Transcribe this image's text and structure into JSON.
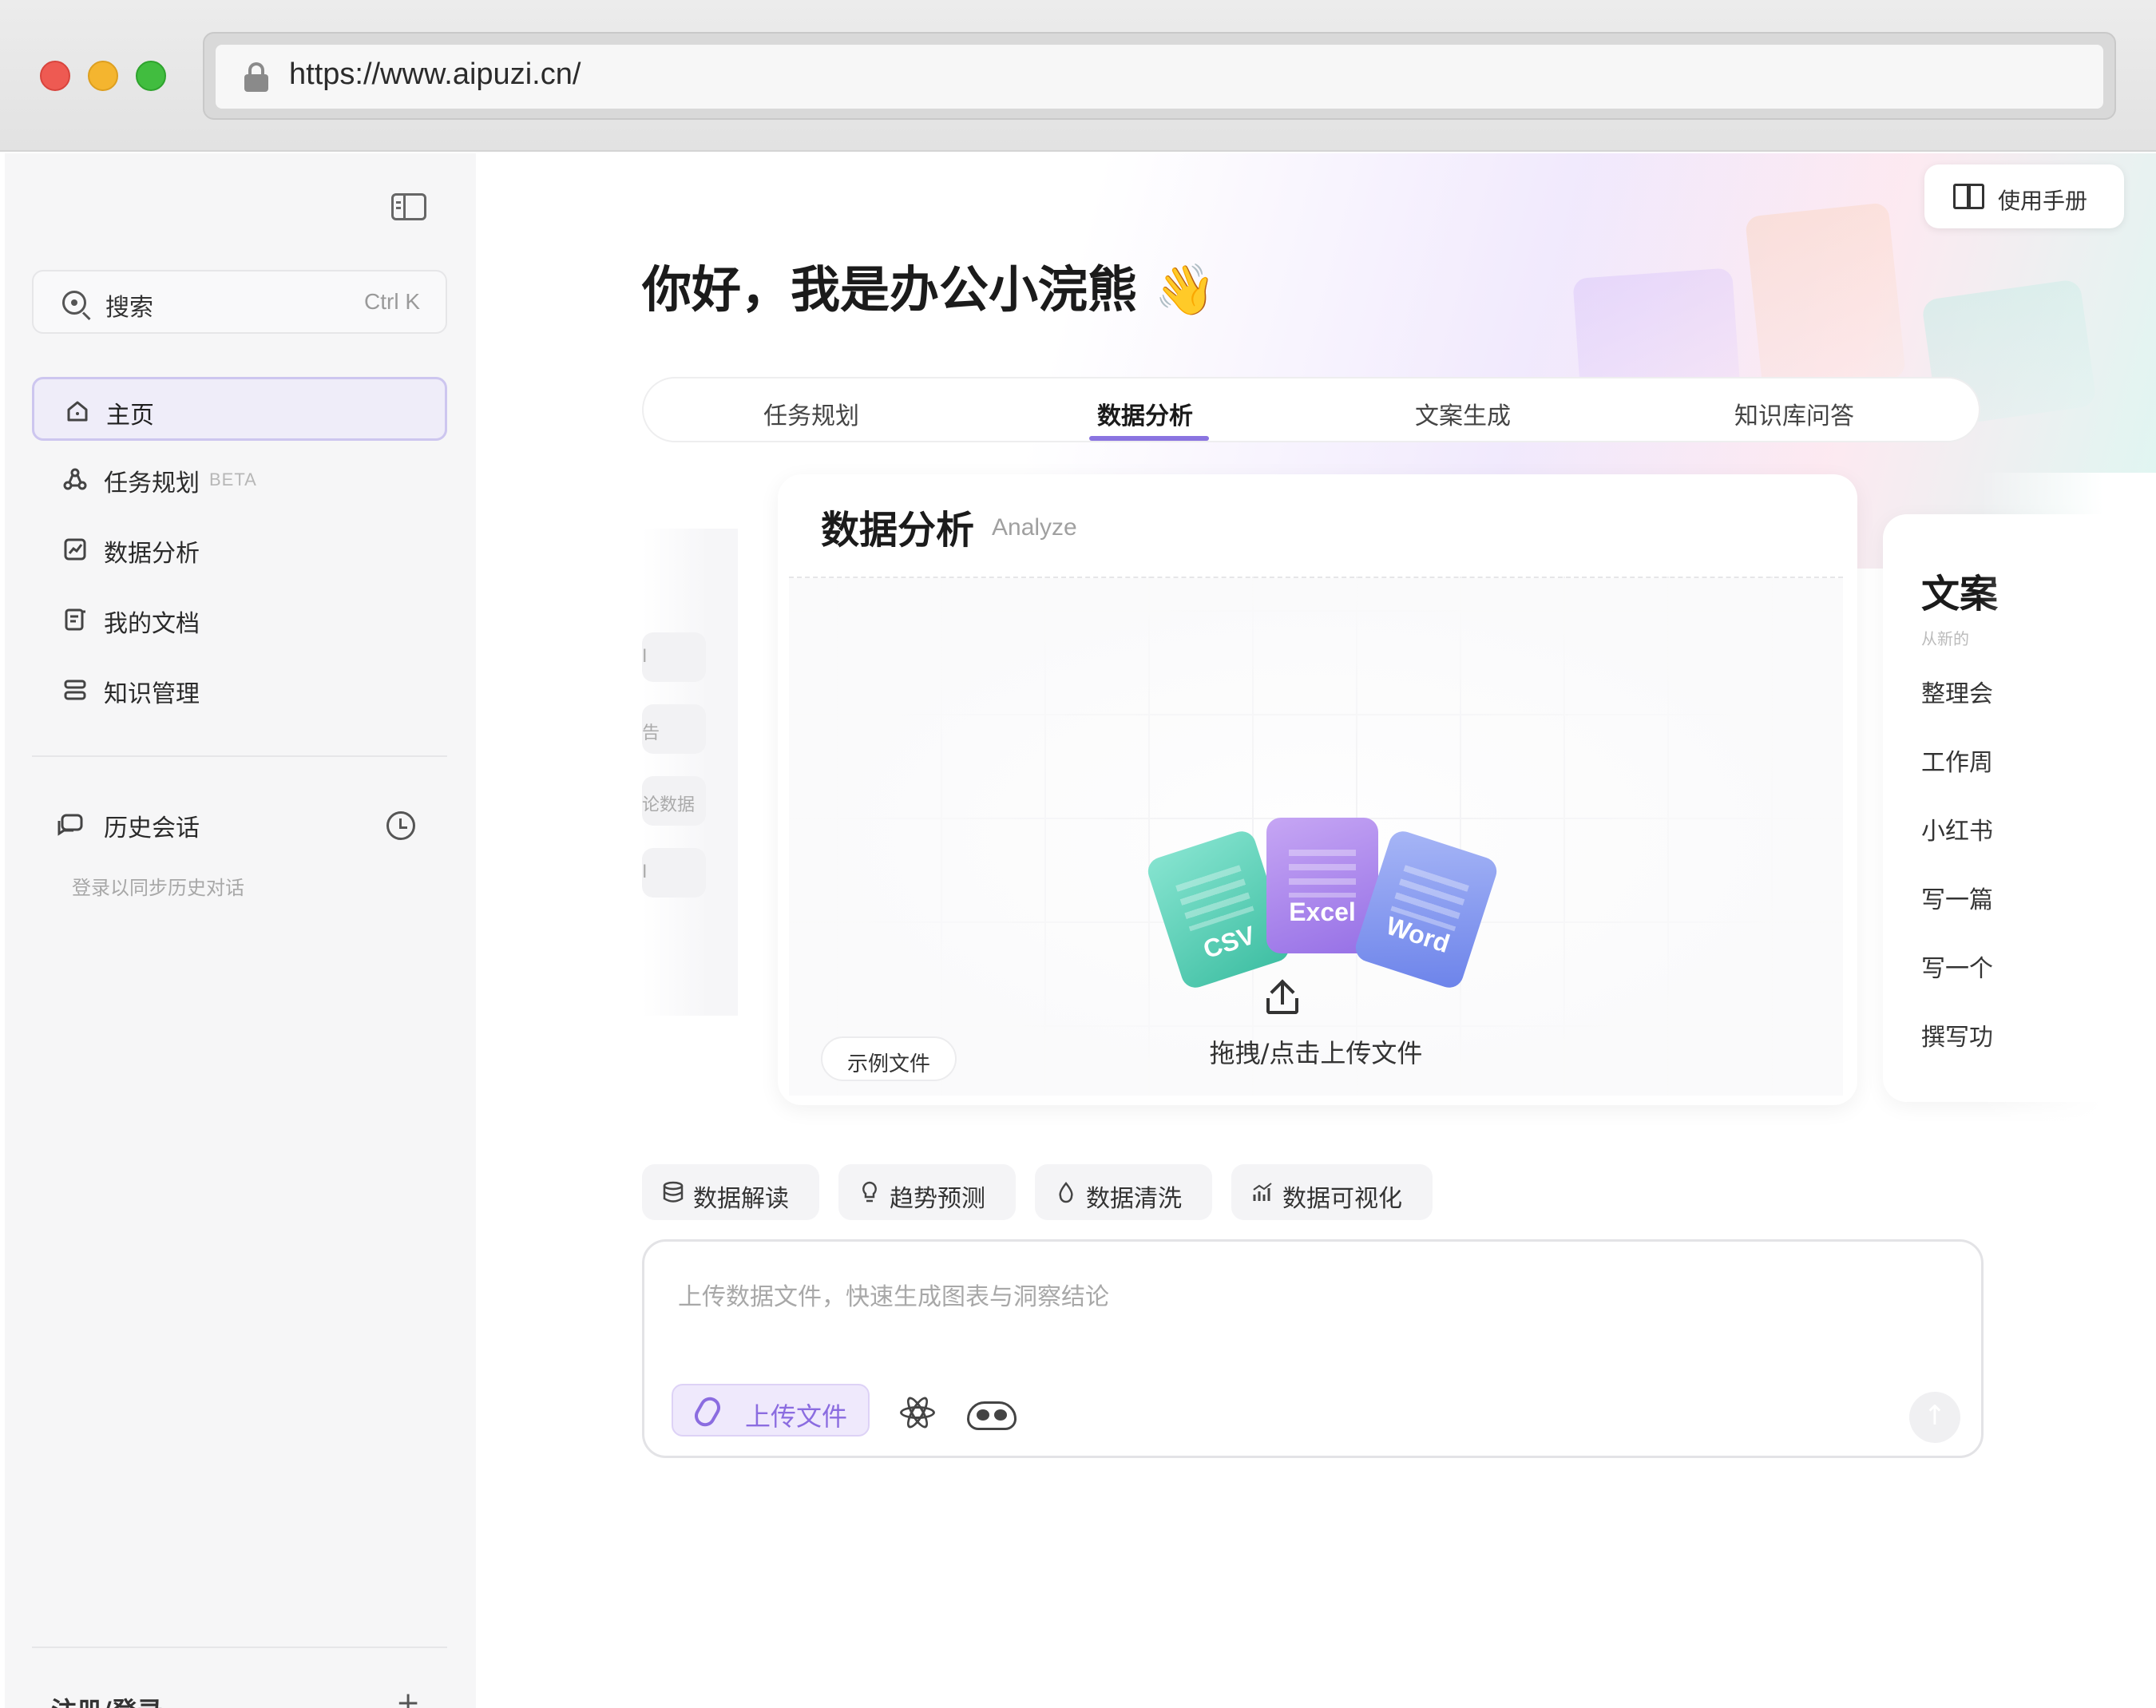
{
  "browser": {
    "url": "https://www.aipuzi.cn/"
  },
  "sidebar": {
    "search": {
      "label": "搜索",
      "shortcut": "Ctrl K"
    },
    "nav": [
      {
        "label": "主页",
        "icon": "home-icon",
        "active": true
      },
      {
        "label": "任务规划",
        "badge": "BETA",
        "icon": "task-plan-icon"
      },
      {
        "label": "数据分析",
        "icon": "chart-icon"
      },
      {
        "label": "我的文档",
        "icon": "document-icon"
      },
      {
        "label": "知识管理",
        "icon": "knowledge-icon"
      }
    ],
    "history": {
      "title": "历史会话",
      "hint": "登录以同步历史对话"
    },
    "login": "注册/登录",
    "login_plus": "+"
  },
  "header": {
    "manual": "使用手册"
  },
  "main": {
    "greeting": "你好，我是办公小浣熊 👋",
    "tabs": [
      {
        "label": "任务规划"
      },
      {
        "label": "数据分析",
        "active": true
      },
      {
        "label": "文案生成"
      },
      {
        "label": "知识库问答"
      }
    ],
    "left_card_fragments": [
      "I",
      "告",
      "论数据",
      "I"
    ],
    "card": {
      "title": "数据分析",
      "subtitle": "Analyze",
      "file_types": [
        "CSV",
        "Excel",
        "Word"
      ],
      "upload_label": "拖拽/点击上传文件",
      "sample_button": "示例文件"
    },
    "right_card": {
      "title": "文案",
      "subtitle": "从新的",
      "items": [
        "整理会",
        "工作周",
        "小红书",
        "写一篇",
        "写一个",
        "撰写功"
      ]
    },
    "chips": [
      {
        "label": "数据解读",
        "icon": "database-icon"
      },
      {
        "label": "趋势预测",
        "icon": "lightbulb-icon"
      },
      {
        "label": "数据清洗",
        "icon": "droplet-icon"
      },
      {
        "label": "数据可视化",
        "icon": "bar-chart-icon"
      }
    ],
    "input": {
      "placeholder": "上传数据文件，快速生成图表与洞察结论",
      "upload_button": "上传文件"
    }
  },
  "colors": {
    "accent": "#8b6ce0",
    "active_nav_bg": "#efedf9",
    "tab_underline": "#8a74e0"
  }
}
